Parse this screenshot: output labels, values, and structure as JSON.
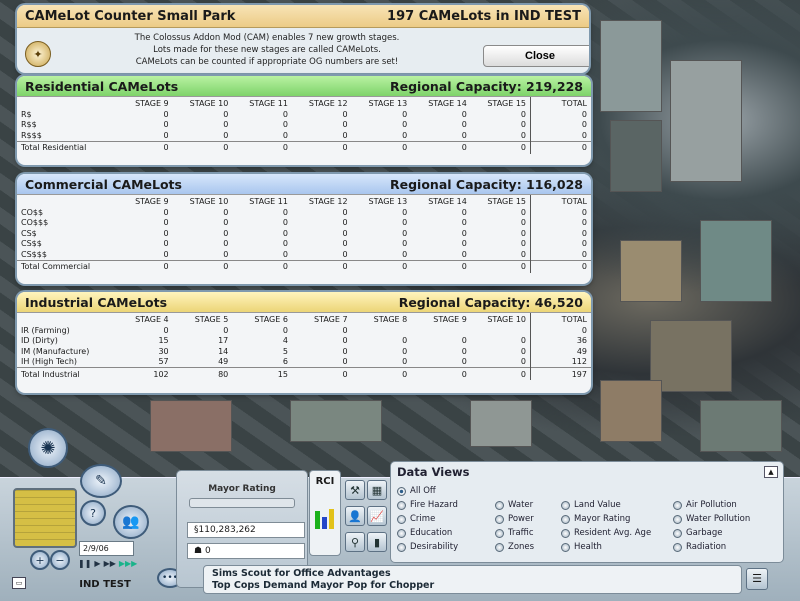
{
  "window": {
    "title": "CAMeLot Counter Small Park",
    "subtitle": "197 CAMeLots in IND TEST",
    "description_lines": [
      "The Colossus Addon Mod (CAM) enables 7 new growth stages.",
      "Lots made for these new stages are called CAMeLots.",
      "CAMeLots can be counted if appropriate OG numbers are set!"
    ],
    "close_label": "Close"
  },
  "residential": {
    "title": "Residential CAMeLots",
    "capacity": "Regional Capacity: 219,228",
    "columns": [
      "STAGE 9",
      "STAGE 10",
      "STAGE 11",
      "STAGE 12",
      "STAGE 13",
      "STAGE 14",
      "STAGE 15",
      "TOTAL"
    ],
    "rows": [
      {
        "label": "R$",
        "values": [
          "0",
          "0",
          "0",
          "0",
          "0",
          "0",
          "0",
          "0"
        ]
      },
      {
        "label": "R$$",
        "values": [
          "0",
          "0",
          "0",
          "0",
          "0",
          "0",
          "0",
          "0"
        ]
      },
      {
        "label": "R$$$",
        "values": [
          "0",
          "0",
          "0",
          "0",
          "0",
          "0",
          "0",
          "0"
        ]
      }
    ],
    "total": {
      "label": "Total Residential",
      "values": [
        "0",
        "0",
        "0",
        "0",
        "0",
        "0",
        "0",
        "0"
      ]
    }
  },
  "commercial": {
    "title": "Commercial CAMeLots",
    "capacity": "Regional Capacity: 116,028",
    "columns": [
      "STAGE 9",
      "STAGE 10",
      "STAGE 11",
      "STAGE 12",
      "STAGE 13",
      "STAGE 14",
      "STAGE 15",
      "TOTAL"
    ],
    "rows": [
      {
        "label": "CO$$",
        "values": [
          "0",
          "0",
          "0",
          "0",
          "0",
          "0",
          "0",
          "0"
        ]
      },
      {
        "label": "CO$$$",
        "values": [
          "0",
          "0",
          "0",
          "0",
          "0",
          "0",
          "0",
          "0"
        ]
      },
      {
        "label": "CS$",
        "values": [
          "0",
          "0",
          "0",
          "0",
          "0",
          "0",
          "0",
          "0"
        ]
      },
      {
        "label": "CS$$",
        "values": [
          "0",
          "0",
          "0",
          "0",
          "0",
          "0",
          "0",
          "0"
        ]
      },
      {
        "label": "CS$$$",
        "values": [
          "0",
          "0",
          "0",
          "0",
          "0",
          "0",
          "0",
          "0"
        ]
      }
    ],
    "total": {
      "label": "Total Commercial",
      "values": [
        "0",
        "0",
        "0",
        "0",
        "0",
        "0",
        "0",
        "0"
      ]
    }
  },
  "industrial": {
    "title": "Industrial CAMeLots",
    "capacity": "Regional Capacity: 46,520",
    "columns": [
      "STAGE 4",
      "STAGE 5",
      "STAGE 6",
      "STAGE 7",
      "STAGE 8",
      "STAGE 9",
      "STAGE 10",
      "TOTAL"
    ],
    "rows": [
      {
        "label": "IR (Farming)",
        "values": [
          "0",
          "0",
          "0",
          "0",
          "",
          "",
          "",
          "0"
        ]
      },
      {
        "label": "ID (Dirty)",
        "values": [
          "15",
          "17",
          "4",
          "0",
          "0",
          "0",
          "0",
          "36"
        ]
      },
      {
        "label": "IM (Manufacture)",
        "values": [
          "30",
          "14",
          "5",
          "0",
          "0",
          "0",
          "0",
          "49"
        ]
      },
      {
        "label": "IH (High Tech)",
        "values": [
          "57",
          "49",
          "6",
          "0",
          "0",
          "0",
          "0",
          "112"
        ]
      }
    ],
    "total": {
      "label": "Total Industrial",
      "values": [
        "102",
        "80",
        "15",
        "0",
        "0",
        "0",
        "0",
        "197"
      ]
    }
  },
  "toolbar": {
    "date": "2/9/06",
    "city_name": "IND TEST",
    "mayor_rating_label": "Mayor Rating",
    "funds": "§110,283,262",
    "population": "0",
    "rci_label": "RCI",
    "data_views": {
      "title": "Data Views",
      "options": [
        "All Off",
        "Fire Hazard",
        "Crime",
        "Education",
        "Desirability",
        "Water",
        "Power",
        "Traffic",
        "Zones",
        "Land Value",
        "Mayor Rating",
        "Resident Avg. Age",
        "Health",
        "Air Pollution",
        "Water Pollution",
        "Garbage",
        "Radiation"
      ]
    },
    "news": [
      "Sims Scout for Office Advantages",
      "Top Cops Demand Mayor Pop for Chopper"
    ]
  },
  "colors": {
    "residential": "#7ed36a",
    "commercial": "#a9c6ee",
    "industrial": "#ecd577",
    "title_bar": "#eccb86"
  }
}
